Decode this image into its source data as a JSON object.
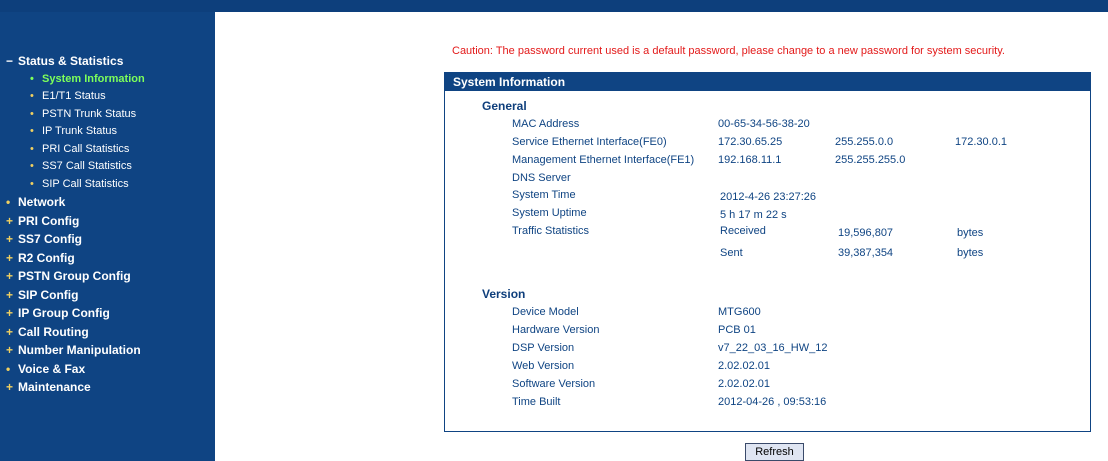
{
  "sidebar": {
    "status_statistics": "Status & Statistics",
    "status_items": [
      "System Information",
      "E1/T1 Status",
      "PSTN Trunk Status",
      "IP Trunk Status",
      "PRI Call Statistics",
      "SS7 Call Statistics",
      "SIP Call Statistics"
    ],
    "menu": [
      {
        "mark": "•",
        "label": "Network"
      },
      {
        "mark": "+",
        "label": "PRI Config"
      },
      {
        "mark": "+",
        "label": "SS7 Config"
      },
      {
        "mark": "+",
        "label": "R2 Config"
      },
      {
        "mark": "+",
        "label": "PSTN Group Config"
      },
      {
        "mark": "+",
        "label": "SIP Config"
      },
      {
        "mark": "+",
        "label": "IP Group Config"
      },
      {
        "mark": "+",
        "label": "Call Routing"
      },
      {
        "mark": "+",
        "label": "Number Manipulation"
      },
      {
        "mark": "•",
        "label": "Voice & Fax"
      },
      {
        "mark": "+",
        "label": "Maintenance"
      }
    ]
  },
  "caution": "Caution: The password current used is a default password, please change to a new password for system security.",
  "panel": {
    "title": "System Information",
    "general": {
      "title": "General",
      "mac_label": "MAC Address",
      "mac_value": "00-65-34-56-38-20",
      "fe0_label": "Service Ethernet Interface(FE0)",
      "fe0_ip": "172.30.65.25",
      "fe0_mask": "255.255.0.0",
      "fe0_gw": "172.30.0.1",
      "fe1_label": "Management Ethernet Interface(FE1)",
      "fe1_ip": "192.168.11.1",
      "fe1_mask": "255.255.255.0",
      "dns_label": "DNS Server",
      "time_label": "System Time",
      "time_value": "2012-4-26  23:27:26",
      "uptime_label": "System Uptime",
      "uptime_value": "5 h 17 m 22 s",
      "traffic_label": "Traffic Statistics",
      "received_label": "Received",
      "received_value": "19,596,807",
      "received_unit": "bytes",
      "sent_label": "Sent",
      "sent_value": "39,387,354",
      "sent_unit": "bytes"
    },
    "version": {
      "title": "Version",
      "device_label": "Device Model",
      "device_value": "MTG600",
      "hw_label": "Hardware Version",
      "hw_value": "PCB 01",
      "dsp_label": "DSP Version",
      "dsp_value": "v7_22_03_16_HW_12",
      "web_label": "Web Version",
      "web_value": "2.02.02.01",
      "sw_label": "Software Version",
      "sw_value": "2.02.02.01",
      "built_label": "Time Built",
      "built_value": "2012-04-26 , 09:53:16"
    }
  },
  "refresh_label": "Refresh",
  "colors": {
    "sidebar": "#0f4483",
    "active_item": "#7dff5a",
    "caution": "#e31a1a",
    "text": "#0f4483"
  }
}
